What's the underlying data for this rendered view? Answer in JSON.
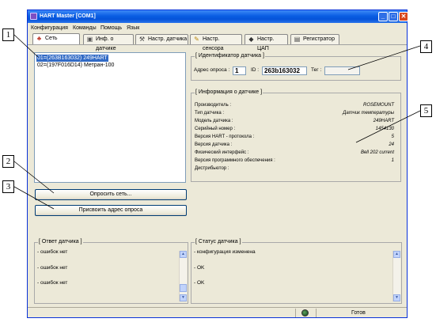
{
  "window": {
    "title": "HART Master [COM1]",
    "minimize": "_",
    "maximize": "□",
    "close": "✕"
  },
  "menu": [
    "Конфигурация",
    "Команды",
    "Помощь",
    "Язык"
  ],
  "tabs": [
    {
      "label": "Сеть",
      "icon": "network-icon"
    },
    {
      "label": "Инф. о датчике",
      "icon": "sensor-info-icon"
    },
    {
      "label": "Настр. датчика",
      "icon": "sensor-settings-icon"
    },
    {
      "label": "Настр. сенсора",
      "icon": "sensor-calibrate-icon"
    },
    {
      "label": "Настр. ЦАП",
      "icon": "dac-icon"
    },
    {
      "label": "Регистратор",
      "icon": "recorder-icon"
    }
  ],
  "device_list": [
    {
      "text": "01=(263B163032) 249HART",
      "selected": true
    },
    {
      "text": "02=(197F016D14) Метран-100",
      "selected": false
    }
  ],
  "buttons": {
    "poll_network": "Опросить сеть...",
    "assign_address": "Присвоить адрес опроса"
  },
  "identifier": {
    "title": "[ Идентификатор датчика ]",
    "poll_address_label": "Адрес опроса :",
    "poll_address_value": "1",
    "id_label": "ID :",
    "id_value": "263b163032",
    "tag_label": "Тег :",
    "tag_value": ""
  },
  "info": {
    "title": "[ Информация о датчике ]",
    "rows": [
      {
        "label": "Производитель :",
        "value": "ROSEMOUNT"
      },
      {
        "label": "Тип датчика :",
        "value": "Датчик температуры"
      },
      {
        "label": "Модель датчика :",
        "value": "249HART"
      },
      {
        "label": "Серийный номер :",
        "value": "1454130"
      },
      {
        "label": "Версия HART - протокола :",
        "value": "5"
      },
      {
        "label": "Версия датчика :",
        "value": "24"
      },
      {
        "label": "Физический интерфейс :",
        "value": "Bell 202 current"
      },
      {
        "label": "Версия программного обеспечения :",
        "value": "1"
      },
      {
        "label": "Дистрибьютор :",
        "value": ""
      }
    ]
  },
  "response": {
    "title": "[ Ответ датчика ]",
    "lines": [
      "- ошибок нет",
      "- ошибок нет",
      "- ошибок нет"
    ]
  },
  "status_panel": {
    "title": "[ Статус датчика ]",
    "lines": [
      "- конфигурация изменена",
      "- OK",
      "- OK"
    ]
  },
  "statusbar": {
    "text": "Готов"
  },
  "callouts": [
    "1",
    "2",
    "3",
    "4",
    "5"
  ],
  "colors": {
    "title_bar": "#0a5ee3",
    "selection": "#316ac5",
    "window_bg": "#ece9d8"
  }
}
